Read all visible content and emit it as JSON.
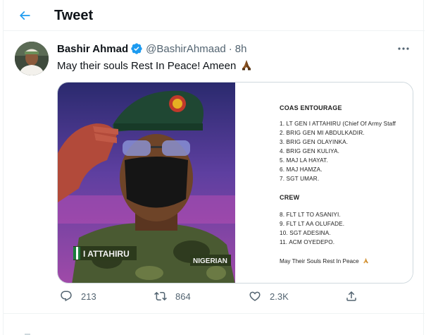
{
  "header": {
    "title": "Tweet"
  },
  "tweet": {
    "author_name": "Bashir Ahmad",
    "handle": "@BashirAhmaad",
    "separator": "·",
    "time": "8h",
    "text": "May their souls Rest In Peace! Ameen",
    "text_emoji": "folded-hands-icon",
    "media": {
      "photo_name_tag": "I ATTAHIRU",
      "photo_flag_tag": "NIGERIAN",
      "doc": {
        "heading_entourage": "COAS ENTOURAGE",
        "entourage": [
          "1. LT GEN I ATTAHIRU (Chief Of Army Staff",
          "2. BRIG GEN MI ABDULKADIR.",
          "3. BRIG GEN OLAYINKA.",
          "4. BRIG GEN KULIYA.",
          "5. MAJ LA HAYAT.",
          "6. MAJ HAMZA.",
          "7. SGT UMAR."
        ],
        "heading_crew": "CREW",
        "crew": [
          "8. FLT LT TO ASANIYI.",
          "9. FLT LT AA OLUFADE.",
          "10. SGT ADESINA.",
          "11. ACM OYEDEPO."
        ],
        "footer": "May Their Souls Rest In Peace"
      }
    },
    "actions": {
      "reply_count": "213",
      "retweet_count": "864",
      "like_count": "2.3K"
    }
  },
  "colors": {
    "accent": "#1d9bf0",
    "text_primary": "#0f1419",
    "text_secondary": "#536471",
    "border": "#eff3f4"
  }
}
